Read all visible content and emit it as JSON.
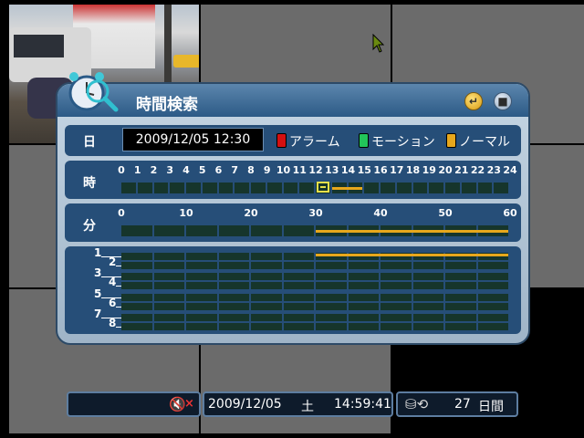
{
  "dialog": {
    "title": "時間検索",
    "date_label": "日",
    "date_value": "2009/12/05 12:30",
    "legend": [
      {
        "label": "アラーム",
        "color": "#d41010"
      },
      {
        "label": "モーション",
        "color": "#22c55a"
      },
      {
        "label": "ノーマル",
        "color": "#e7a71c"
      }
    ],
    "hour_label": "時",
    "hours": [
      "0",
      "1",
      "2",
      "3",
      "4",
      "5",
      "6",
      "7",
      "8",
      "9",
      "10",
      "11",
      "12",
      "13",
      "14",
      "15",
      "16",
      "17",
      "18",
      "19",
      "20",
      "21",
      "22",
      "23",
      "24"
    ],
    "hour_selected": 12,
    "hour_recorded_ranges": [
      [
        13,
        15
      ]
    ],
    "minute_label": "分",
    "minutes": [
      "0",
      "10",
      "20",
      "30",
      "40",
      "50",
      "60"
    ],
    "minute_recorded_ranges": [
      [
        30,
        60
      ]
    ],
    "channels": [
      "1",
      "2",
      "3",
      "4",
      "5",
      "6",
      "7",
      "8"
    ],
    "channel_recorded": [
      {
        "channel": "1",
        "from": 30,
        "to": 60
      }
    ],
    "icons": {
      "clock": "clock-search-icon",
      "enter": "enter-icon",
      "close": "close-icon"
    }
  },
  "statusbar": {
    "date": "2009/12/05",
    "weekday": "土",
    "time": "14:59:41",
    "hdd_days": "27",
    "hdd_unit": "日間",
    "icons": {
      "audio": "audio-mute-icon",
      "hdd": "hdd-overwrite-icon"
    }
  }
}
